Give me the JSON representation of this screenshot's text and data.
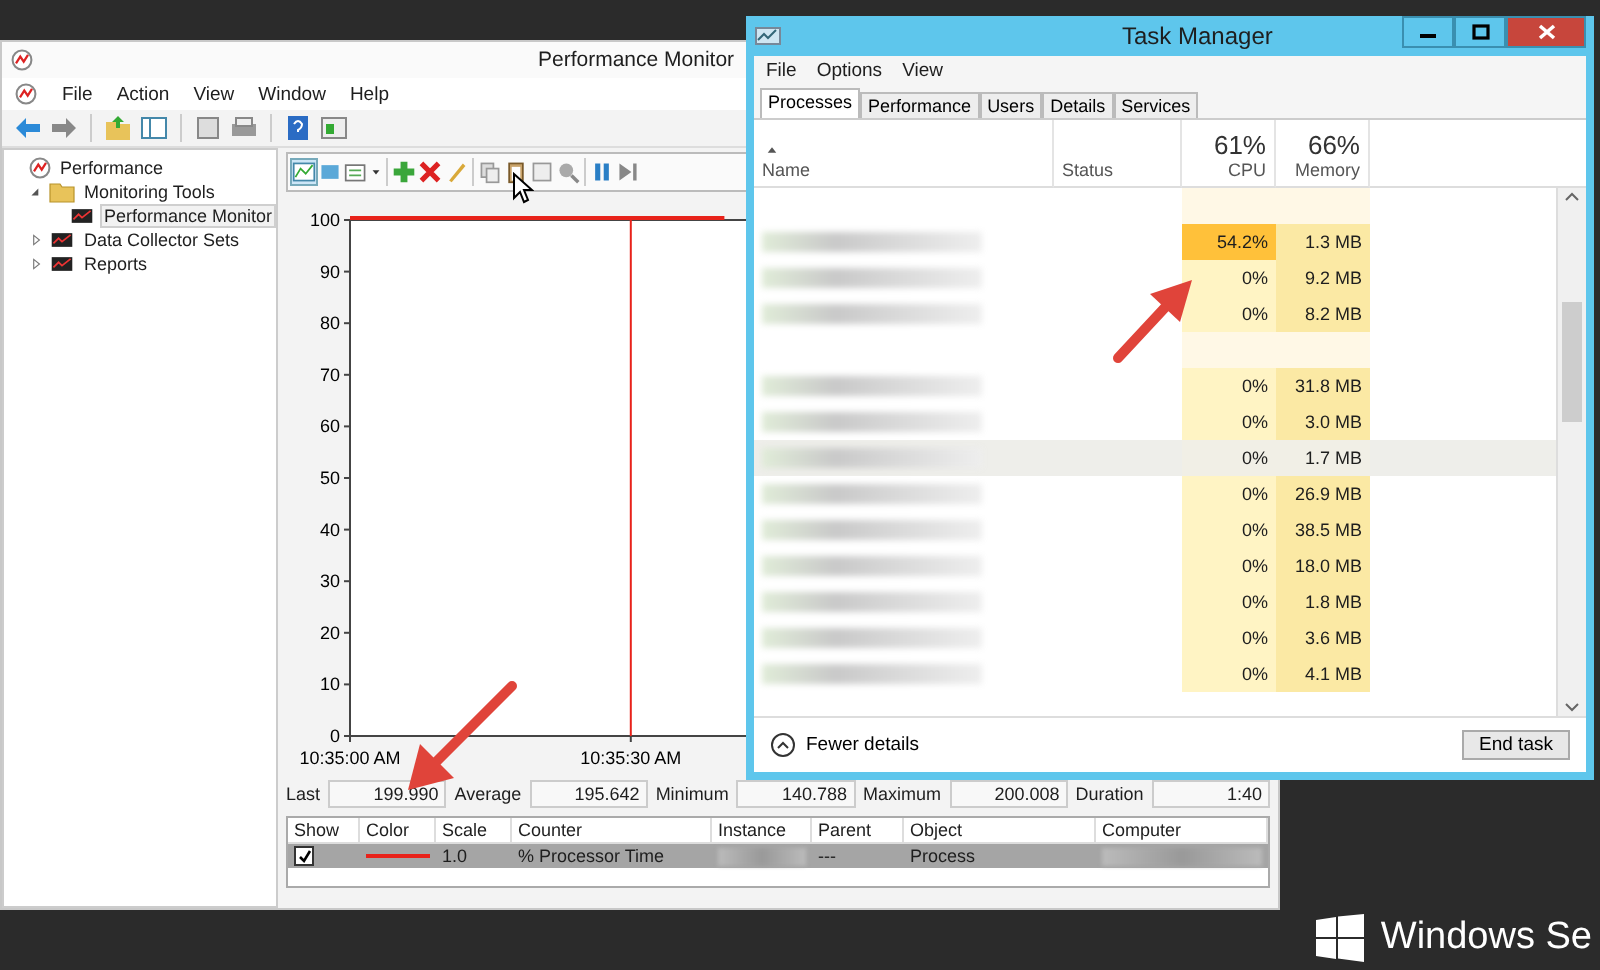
{
  "perf_monitor": {
    "title": "Performance Monitor",
    "menu": [
      "File",
      "Action",
      "View",
      "Window",
      "Help"
    ],
    "tree": [
      {
        "label": "Performance",
        "selected": false,
        "children": [
          {
            "label": "Monitoring Tools",
            "expanded": true,
            "selected": false,
            "children": [
              {
                "label": "Performance Monitor",
                "selected": true
              }
            ]
          },
          {
            "label": "Data Collector Sets",
            "expanded": false,
            "selected": false
          },
          {
            "label": "Reports",
            "expanded": false,
            "selected": false
          }
        ]
      }
    ],
    "chart_data": {
      "type": "line",
      "categories": [
        "10:35:00 AM",
        null,
        null,
        "10:35:30 AM",
        null,
        null,
        null,
        null,
        null,
        null,
        null
      ],
      "ylim": [
        0,
        100
      ],
      "yticks": [
        0,
        10,
        20,
        30,
        40,
        50,
        60,
        70,
        80,
        90,
        100
      ],
      "series": [
        {
          "color": "#e8221a",
          "values": [
            100,
            100,
            100,
            100,
            100,
            null,
            null,
            null,
            null,
            null,
            null
          ]
        }
      ],
      "ref_lines": [
        {
          "axis": "x",
          "value": "10:35:30 AM"
        }
      ]
    },
    "stats": [
      {
        "label": "Last",
        "value": "199.990"
      },
      {
        "label": "Average",
        "value": "195.642"
      },
      {
        "label": "Minimum",
        "value": "140.788"
      },
      {
        "label": "Maximum",
        "value": "200.008"
      },
      {
        "label": "Duration",
        "value": "1:40"
      }
    ],
    "counters": {
      "columns": [
        "Show",
        "Color",
        "Scale",
        "Counter",
        "Instance",
        "Parent",
        "Object",
        "Computer"
      ],
      "rows": [
        {
          "checked": true,
          "selected": true,
          "color": "#e8221a",
          "scale": "1.0",
          "counter": "% Processor Time",
          "parent": "---",
          "object": "Process"
        }
      ]
    }
  },
  "task_manager": {
    "title": "Task Manager",
    "menu": [
      "File",
      "Options",
      "View"
    ],
    "tabs": [
      {
        "label": "Processes",
        "selected": true
      },
      {
        "label": "Performance",
        "selected": false
      },
      {
        "label": "Users",
        "selected": false
      },
      {
        "label": "Details",
        "selected": false
      },
      {
        "label": "Services",
        "selected": false
      }
    ],
    "columns": {
      "name": "Name",
      "status": "Status",
      "cpu_total": "61%",
      "cpu": "CPU",
      "memory_total": "66%",
      "memory": "Memory"
    },
    "rows": [
      {
        "kind": "group",
        "selected": false,
        "hot": false
      },
      {
        "kind": "process",
        "cpu": "54.2%",
        "memory": "1.3 MB",
        "selected": false,
        "hot": true
      },
      {
        "kind": "process",
        "cpu": "0%",
        "memory": "9.2 MB",
        "selected": false,
        "hot": false
      },
      {
        "kind": "process",
        "cpu": "0%",
        "memory": "8.2 MB",
        "selected": false,
        "hot": false
      },
      {
        "kind": "group",
        "selected": false,
        "hot": false
      },
      {
        "kind": "process",
        "cpu": "0%",
        "memory": "31.8 MB",
        "selected": false,
        "hot": false
      },
      {
        "kind": "process",
        "cpu": "0%",
        "memory": "3.0 MB",
        "selected": false,
        "hot": false
      },
      {
        "kind": "process",
        "cpu": "0%",
        "memory": "1.7 MB",
        "selected": true,
        "hot": false
      },
      {
        "kind": "process",
        "cpu": "0%",
        "memory": "26.9 MB",
        "selected": false,
        "hot": false
      },
      {
        "kind": "process",
        "cpu": "0%",
        "memory": "38.5 MB",
        "selected": false,
        "hot": false
      },
      {
        "kind": "process",
        "cpu": "0%",
        "memory": "18.0 MB",
        "selected": false,
        "hot": false
      },
      {
        "kind": "process",
        "cpu": "0%",
        "memory": "1.8 MB",
        "selected": false,
        "hot": false
      },
      {
        "kind": "process",
        "cpu": "0%",
        "memory": "3.6 MB",
        "selected": false,
        "hot": false
      },
      {
        "kind": "process",
        "cpu": "0%",
        "memory": "4.1 MB",
        "selected": false,
        "hot": false
      }
    ],
    "fewer_details": "Fewer details",
    "end_task": "End task"
  },
  "desktop": {
    "brand": "Windows Se"
  }
}
